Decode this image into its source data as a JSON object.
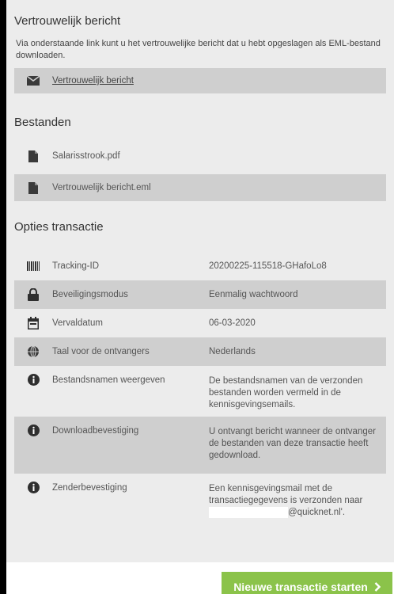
{
  "confidential": {
    "title": "Vertrouwelijk bericht",
    "description": "Via onderstaande link kunt u het vertrouwelijke bericht dat u hebt opgeslagen als EML-bestand downloaden.",
    "link_label": "Vertrouwelijk bericht"
  },
  "files": {
    "title": "Bestanden",
    "items": [
      {
        "name": "Salarisstrook.pdf",
        "icon": "file-icon"
      },
      {
        "name": "Vertrouwelijk bericht.eml",
        "icon": "file-icon"
      }
    ]
  },
  "options": {
    "title": "Opties transactie",
    "rows": [
      {
        "label": "Tracking-ID",
        "value": "20200225-115518-GHafoLo8",
        "icon": "barcode-icon"
      },
      {
        "label": "Beveiligingsmodus",
        "value": "Eenmalig wachtwoord",
        "icon": "lock-icon"
      },
      {
        "label": "Vervaldatum",
        "value": "06-03-2020",
        "icon": "calendar-icon"
      },
      {
        "label": "Taal voor de ontvangers",
        "value": "Nederlands",
        "icon": "globe-icon"
      },
      {
        "label": "Bestandsnamen weergeven",
        "value": "De bestandsnamen van de verzonden bestanden worden vermeld in de kennisgevingsemails.",
        "icon": "info-icon"
      },
      {
        "label": "Downloadbevestiging",
        "value": "U ontvangt bericht wanneer de ontvanger de bestanden van deze transactie heeft gedownload.",
        "icon": "info-icon"
      },
      {
        "label": "Zenderbevestiging",
        "value_prefix": "Een kennisgevingsmail met de transactiegegevens is verzonden naar",
        "value_suffix": "@quicknet.nl'.",
        "icon": "info-icon"
      }
    ]
  },
  "actions": {
    "new_transaction_label": "Nieuwe transactie starten",
    "accent_color": "#8bc34a"
  }
}
